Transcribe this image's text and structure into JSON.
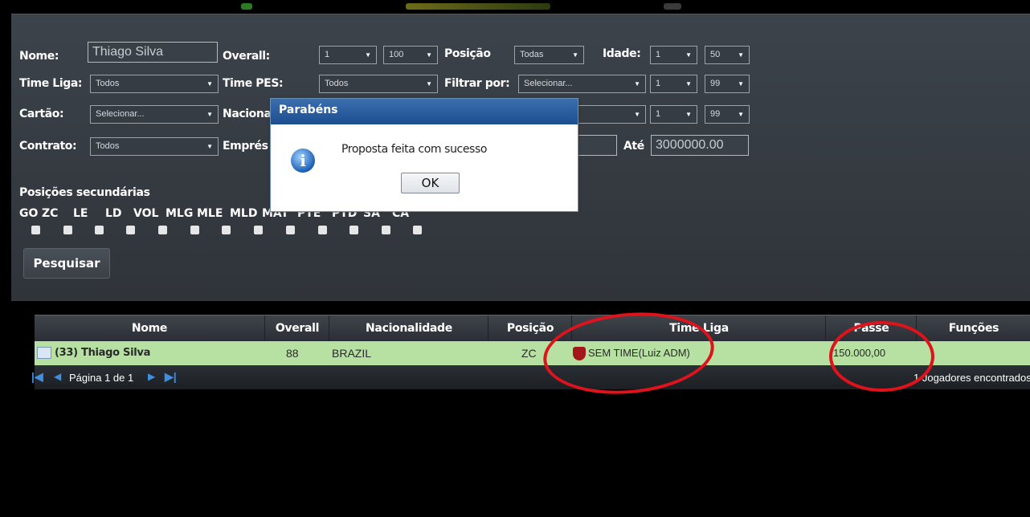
{
  "filters": {
    "nome_label": "Nome:",
    "nome_value": "Thiago Silva",
    "overall_label": "Overall:",
    "overall_min": "1",
    "overall_max": "100",
    "posicao_label": "Posição",
    "posicao_value": "Todas",
    "idade_label": "Idade:",
    "idade_min": "1",
    "idade_max": "50",
    "time_liga_label": "Time Liga:",
    "time_liga_value": "Todos",
    "time_pes_label": "Time PES:",
    "time_pes_value": "Todos",
    "filtrar_por_label": "Filtrar por:",
    "filtrar_por_value": "Selecionar...",
    "filtrar_min": "1",
    "filtrar_max": "99",
    "cartao_label": "Cartão:",
    "cartao_value": "Selecionar...",
    "nacionalidade_label": "Naciona",
    "row3_min": "1",
    "row3_max": "99",
    "contrato_label": "Contrato:",
    "contrato_value": "Todos",
    "emprestimo_label": "Emprés",
    "ate_label": "Até",
    "ate_value": "3000000.00",
    "secondary_positions_label": "Posições secundárias",
    "secondary_positions": [
      "GO",
      "ZC",
      "LE",
      "LD",
      "VOL",
      "MLG",
      "MLE",
      "MLD",
      "MAT",
      "PTE",
      "PTD",
      "SA",
      "CA"
    ],
    "search_button": "Pesquisar"
  },
  "grid": {
    "columns": [
      "Nome",
      "Overall",
      "Nacionalidade",
      "Posição",
      "Time Liga",
      "Passe",
      "Funções"
    ],
    "rows": [
      {
        "nome": "(33) Thiago Silva",
        "overall": "88",
        "nacionalidade": "BRAZIL",
        "posicao": "ZC",
        "time_liga": "SEM TIME(Luiz ADM)",
        "passe": "150.000,00",
        "funcoes": ""
      }
    ],
    "pager_text": "Página 1 de 1",
    "found_text": "1 Jogadores encontrados"
  },
  "dialog": {
    "title": "Parabéns",
    "message": "Proposta feita com sucesso",
    "ok_label": "OK"
  },
  "colors": {
    "row_highlight": "#b6e1a2",
    "annotation_red": "#e0121b",
    "dialog_title": "#1d4f8f"
  }
}
